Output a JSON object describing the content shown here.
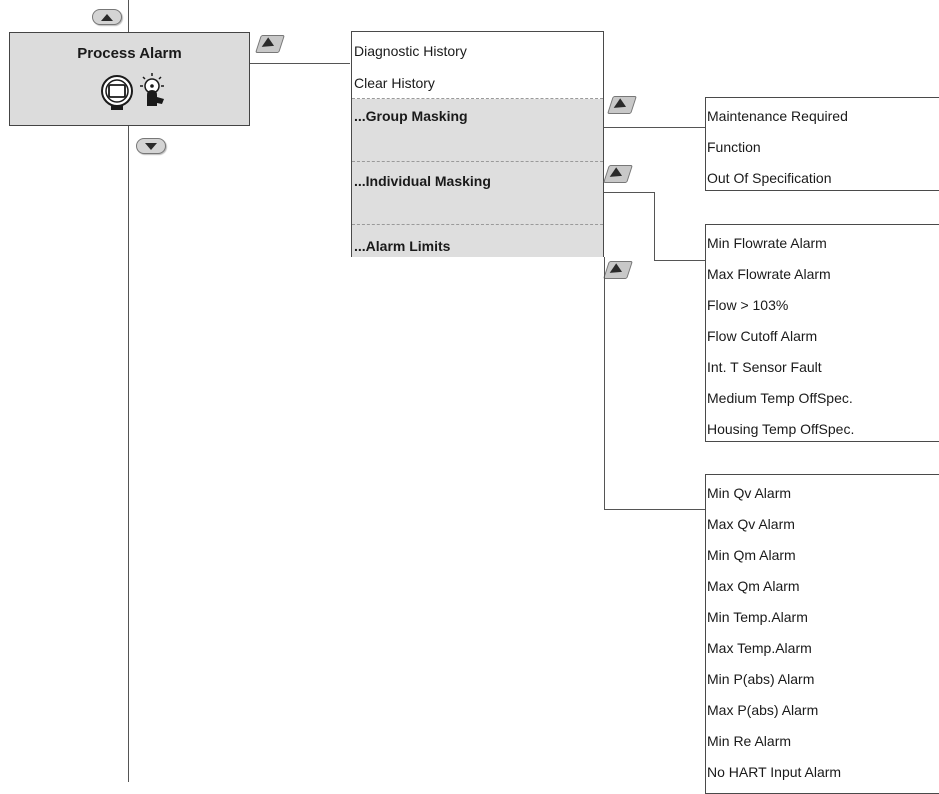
{
  "root": {
    "title": "Process Alarm",
    "icons": [
      "transmitter-icon",
      "alarm-light-icon"
    ]
  },
  "menu": {
    "items": [
      {
        "label": "Diagnostic History"
      },
      {
        "label": "Clear History"
      },
      {
        "label": "...Group Masking"
      },
      {
        "label": "...Individual Masking"
      },
      {
        "label": "...Alarm Limits"
      }
    ]
  },
  "group_masking": {
    "items": [
      "Maintenance Required",
      "Function",
      "Out Of  Specification"
    ]
  },
  "individual_masking": {
    "items": [
      "Min Flowrate Alarm",
      "Max Flowrate Alarm",
      "Flow > 103%",
      "Flow Cutoff Alarm",
      "Int. T Sensor Fault",
      "Medium Temp OffSpec.",
      "Housing Temp OffSpec."
    ]
  },
  "alarm_limits": {
    "items": [
      "Min Qv Alarm",
      "Max Qv Alarm",
      "Min Qm Alarm",
      "Max Qm Alarm",
      "Min Temp.Alarm",
      "Max Temp.Alarm",
      "Min P(abs) Alarm",
      "Max P(abs) Alarm",
      "Min Re Alarm",
      "No HART Input Alarm"
    ]
  },
  "colors": {
    "box_fill": "#dcdcdc",
    "line": "#555555",
    "text": "#1a1a1a"
  }
}
